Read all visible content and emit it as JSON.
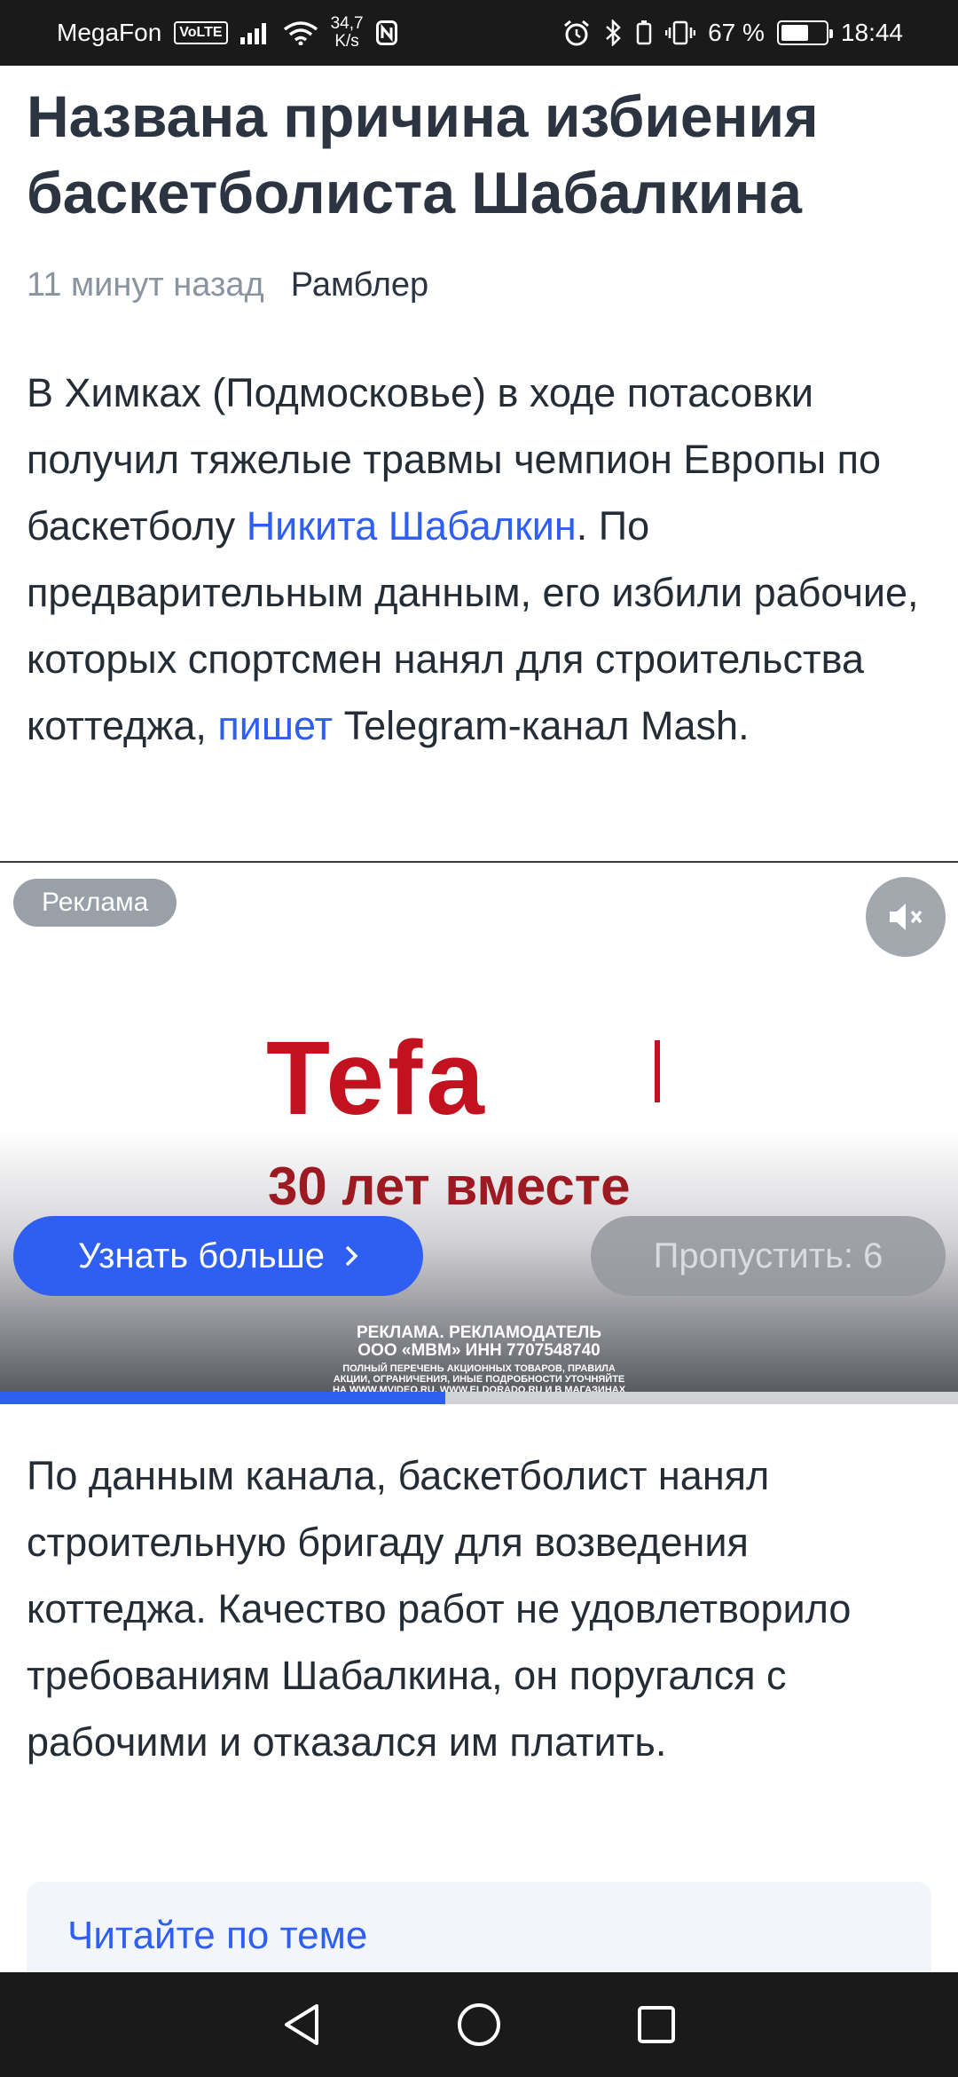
{
  "status_bar": {
    "carrier": "MegaFon",
    "volte": "VoLTE",
    "net_speed_value": "34,7",
    "net_speed_unit": "K/s",
    "battery_percent": "67 %",
    "battery_level": 0.67,
    "time": "18:44"
  },
  "article": {
    "title": "Названа причина избиения баскетболиста Шабалкина",
    "time_ago": "11 минут назад",
    "source": "Рамблер",
    "p1": {
      "part1": "В Химках (Подмосковье) в ходе потасовки получил тяжелые травмы чемпион Европы по баскетболу ",
      "link1": "Никита Шабалкин",
      "part2": ". По предварительным данным, его избили рабочие, которых спортсмен нанял для строительства коттеджа, ",
      "link2": "пишет",
      "part3": " Telegram-канал Mash."
    },
    "p2": "По данным канала, баскетболист нанял строительную бригаду для возведения коттеджа. Качество работ не удовлетворило требованиям Шабалкина, он поругался с рабочими и отказался им платить."
  },
  "ad": {
    "label": "Реклама",
    "brand": "Tefa",
    "slogan": "30 лет вместе",
    "cta": "Узнать больше",
    "skip": "Пропустить: 6",
    "disclaimer_line1": "РЕКЛАМА. РЕКЛАМОДАТЕЛЬ",
    "disclaimer_line2": "ООО «МВМ» ИНН 7707548740",
    "disclaimer_line3": "ПОЛНЫЙ ПЕРЕЧЕНЬ АКЦИОННЫХ ТОВАРОВ, ПРАВИЛА АКЦИИ, ОГРАНИЧЕНИЯ, ИНЫЕ ПОДРОБНОСТИ УТОЧНЯЙТЕ НА WWW.MVIDEO.RU, WWW.ELDORADO.RU И В МАГАЗИНАХ",
    "progress": 0.465
  },
  "related": {
    "title": "Читайте по теме"
  },
  "colors": {
    "accent": "#2f5ef2",
    "brand_red": "#c2121f"
  }
}
